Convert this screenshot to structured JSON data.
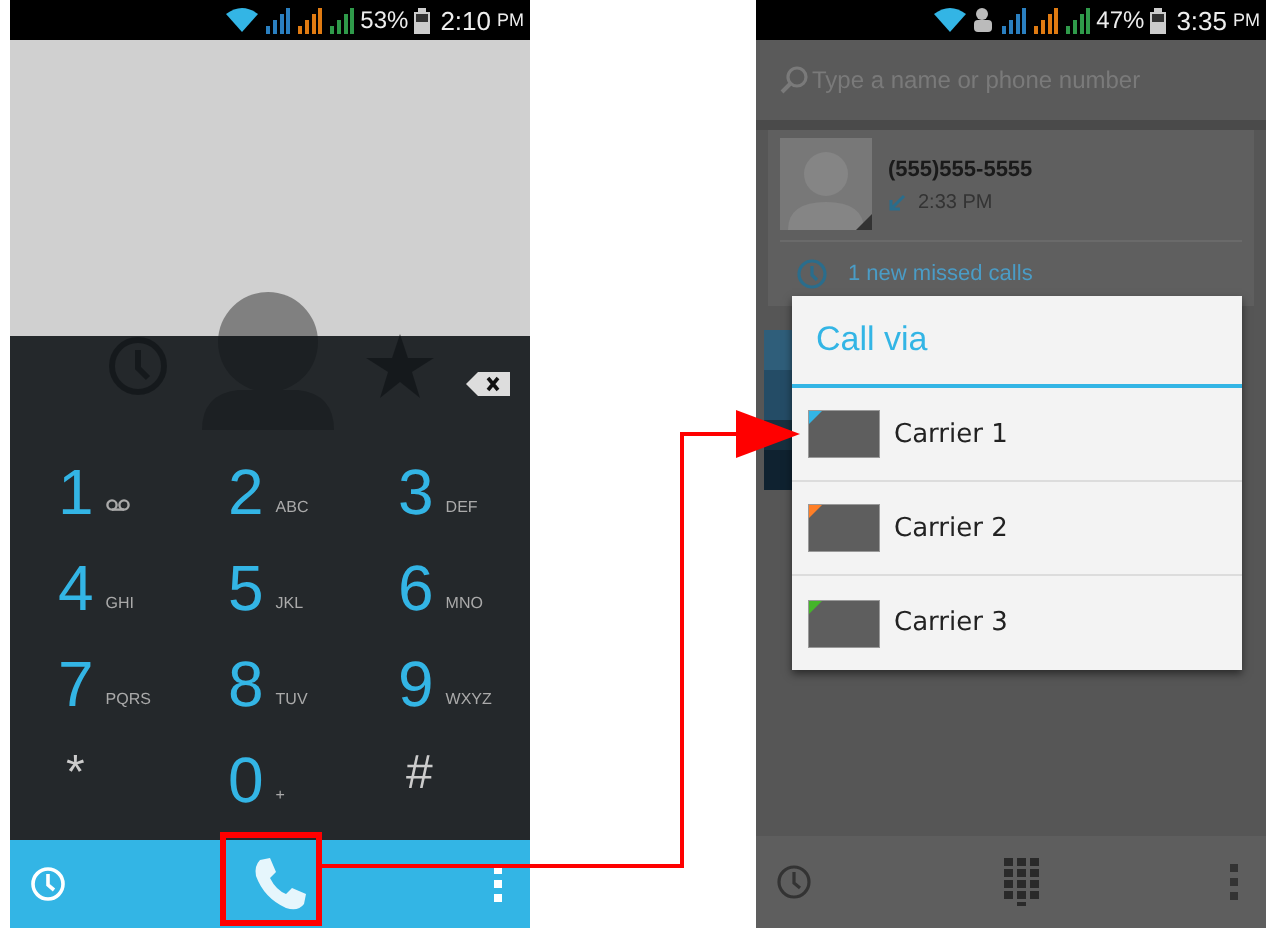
{
  "left_phone": {
    "status_bar": {
      "battery": "53%",
      "time": "2:10",
      "period": "PM"
    },
    "dialpad": {
      "keys": [
        {
          "digit": "1",
          "kind": "voicemail"
        },
        {
          "digit": "2",
          "letters": "ABC",
          "kind": "letters"
        },
        {
          "digit": "3",
          "letters": "DEF",
          "kind": "letters"
        },
        {
          "digit": "4",
          "letters": "GHI",
          "kind": "letters"
        },
        {
          "digit": "5",
          "letters": "JKL",
          "kind": "letters"
        },
        {
          "digit": "6",
          "letters": "MNO",
          "kind": "letters"
        },
        {
          "digit": "7",
          "letters": "PQRS",
          "kind": "letters"
        },
        {
          "digit": "8",
          "letters": "TUV",
          "kind": "letters"
        },
        {
          "digit": "9",
          "letters": "WXYZ",
          "kind": "letters"
        },
        {
          "digit": "*",
          "kind": "symbol"
        },
        {
          "digit": "0",
          "letters": "+",
          "kind": "letters"
        },
        {
          "digit": "#",
          "kind": "symbol"
        }
      ]
    }
  },
  "right_phone": {
    "status_bar": {
      "battery": "47%",
      "time": "3:35",
      "period": "PM"
    },
    "search": {
      "placeholder": "Type a name or phone number"
    },
    "recent_call": {
      "number": "(555)555-5555",
      "time": "2:33 PM",
      "missed": "1 new missed calls"
    },
    "dialog": {
      "title": "Call via",
      "options": [
        {
          "label": "Carrier 1",
          "color": "#33b5e5"
        },
        {
          "label": "Carrier 2",
          "color": "#ff7f27"
        },
        {
          "label": "Carrier 3",
          "color": "#45b52a"
        }
      ]
    }
  }
}
